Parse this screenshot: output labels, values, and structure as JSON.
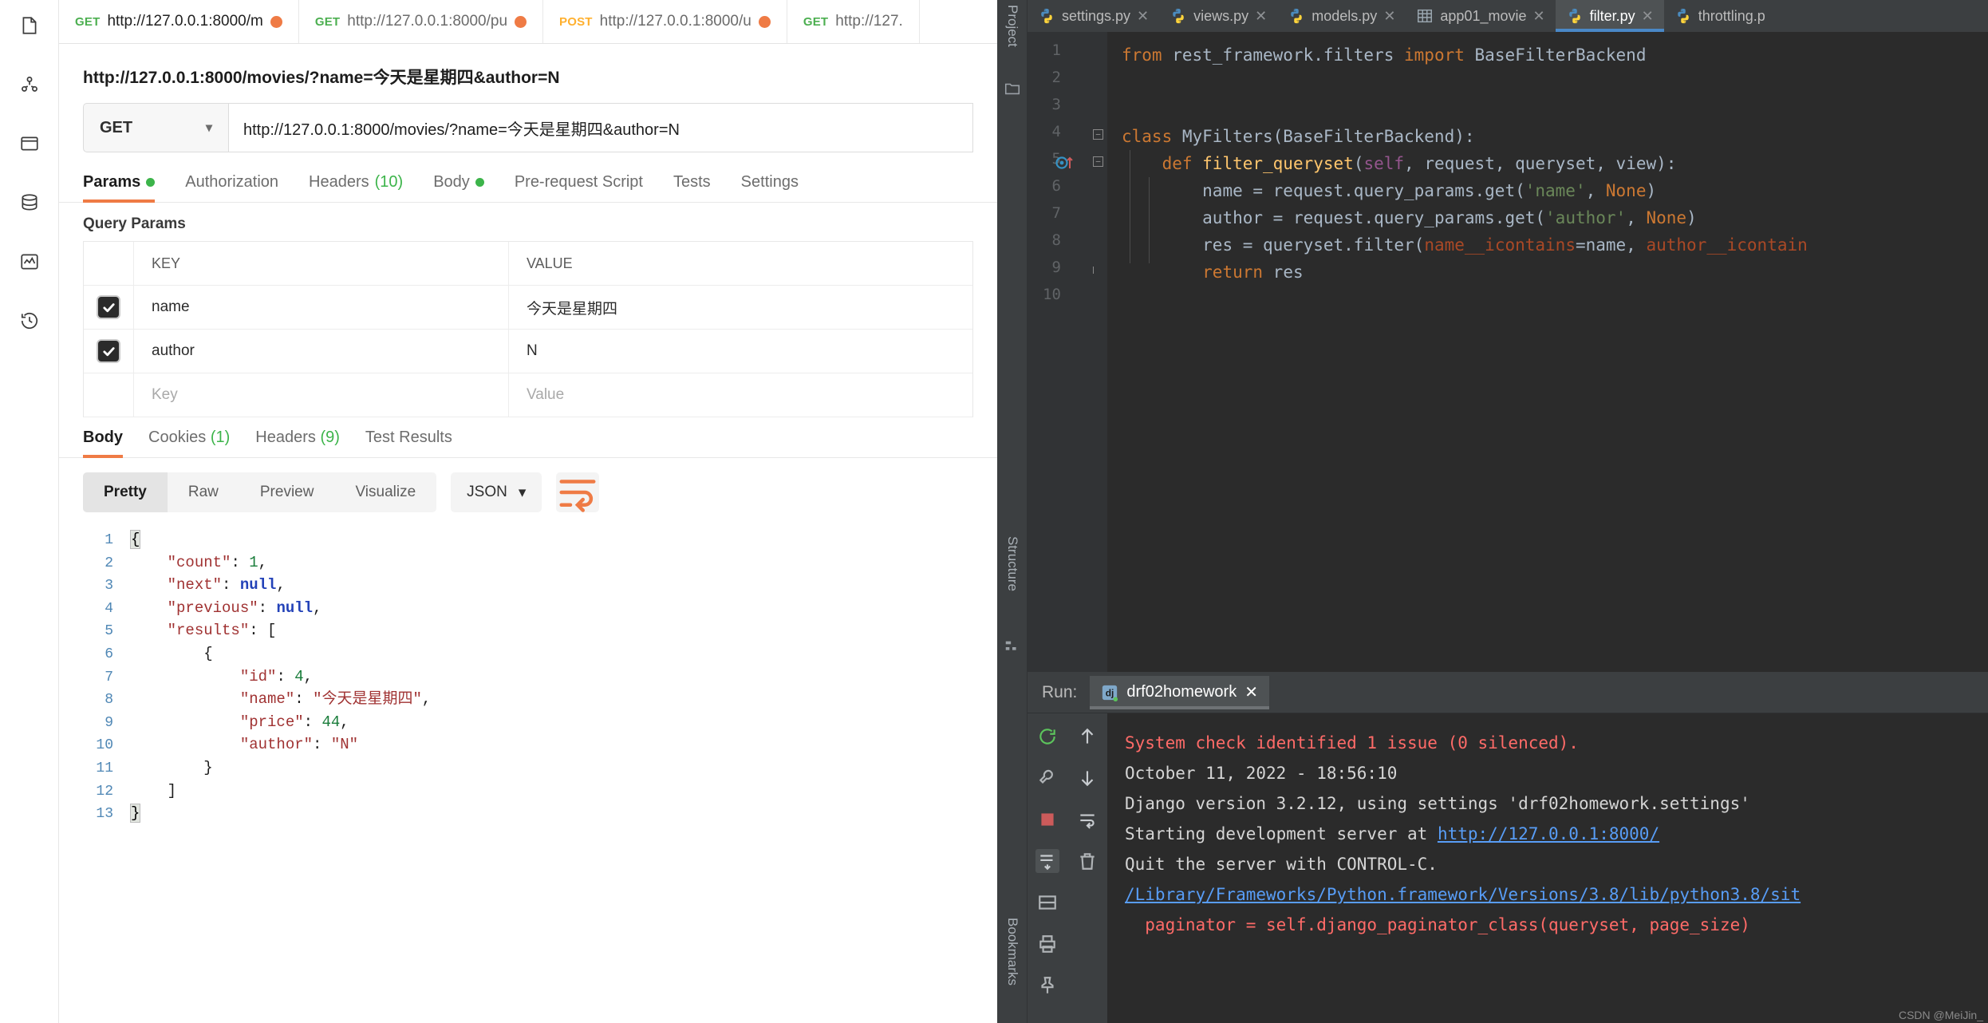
{
  "postman": {
    "rail_icons": [
      "collections-icon",
      "apis-icon",
      "environments-icon",
      "mock-servers-icon",
      "monitors-icon",
      "history-icon"
    ],
    "tabs": [
      {
        "method": "GET",
        "method_class": "get",
        "url": "http://127.0.0.1:8000/m",
        "unsaved": true,
        "active": true
      },
      {
        "method": "GET",
        "method_class": "get",
        "url": "http://127.0.0.1:8000/pu",
        "unsaved": true,
        "active": false
      },
      {
        "method": "POST",
        "method_class": "post",
        "url": "http://127.0.0.1:8000/u",
        "unsaved": true,
        "active": false
      },
      {
        "method": "GET",
        "method_class": "get",
        "url": "http://127.",
        "unsaved": false,
        "active": false
      }
    ],
    "request_name": "http://127.0.0.1:8000/movies/?name=今天是星期四&author=N",
    "method_selected": "GET",
    "url_value": "http://127.0.0.1:8000/movies/?name=今天是星期四&author=N",
    "request_tabs": [
      {
        "label": "Params",
        "dot": true,
        "active": true
      },
      {
        "label": "Authorization",
        "dot": false,
        "active": false
      },
      {
        "label": "Headers",
        "count": "(10)",
        "active": false
      },
      {
        "label": "Body",
        "dot": true,
        "active": false
      },
      {
        "label": "Pre-request Script",
        "active": false
      },
      {
        "label": "Tests",
        "active": false
      },
      {
        "label": "Settings",
        "active": false
      }
    ],
    "query_params_title": "Query Params",
    "table_headers": {
      "key": "KEY",
      "value": "VALUE"
    },
    "params": [
      {
        "checked": true,
        "key": "name",
        "value": "今天是星期四"
      },
      {
        "checked": true,
        "key": "author",
        "value": "N"
      }
    ],
    "new_row": {
      "key_placeholder": "Key",
      "value_placeholder": "Value"
    },
    "response_tabs": [
      {
        "label": "Body",
        "active": true
      },
      {
        "label": "Cookies",
        "count": "(1)",
        "active": false
      },
      {
        "label": "Headers",
        "count": "(9)",
        "active": false
      },
      {
        "label": "Test Results",
        "active": false
      }
    ],
    "view_modes": [
      {
        "label": "Pretty",
        "active": true
      },
      {
        "label": "Raw",
        "active": false
      },
      {
        "label": "Preview",
        "active": false
      },
      {
        "label": "Visualize",
        "active": false
      }
    ],
    "format_selected": "JSON",
    "wrap_icon": "wrap-lines-icon",
    "response_body_lines": [
      {
        "n": "1",
        "indent": 0,
        "tokens": [
          {
            "t": "{",
            "c": "brace-hl"
          }
        ]
      },
      {
        "n": "2",
        "indent": 1,
        "tokens": [
          {
            "t": "\"count\"",
            "c": "tk-key"
          },
          {
            "t": ": ",
            "c": "tk-pl"
          },
          {
            "t": "1",
            "c": "tk-num"
          },
          {
            "t": ",",
            "c": "tk-pl"
          }
        ]
      },
      {
        "n": "3",
        "indent": 1,
        "tokens": [
          {
            "t": "\"next\"",
            "c": "tk-key"
          },
          {
            "t": ": ",
            "c": "tk-pl"
          },
          {
            "t": "null",
            "c": "tk-null"
          },
          {
            "t": ",",
            "c": "tk-pl"
          }
        ]
      },
      {
        "n": "4",
        "indent": 1,
        "tokens": [
          {
            "t": "\"previous\"",
            "c": "tk-key"
          },
          {
            "t": ": ",
            "c": "tk-pl"
          },
          {
            "t": "null",
            "c": "tk-null"
          },
          {
            "t": ",",
            "c": "tk-pl"
          }
        ]
      },
      {
        "n": "5",
        "indent": 1,
        "tokens": [
          {
            "t": "\"results\"",
            "c": "tk-key"
          },
          {
            "t": ": [",
            "c": "tk-pl"
          }
        ]
      },
      {
        "n": "6",
        "indent": 2,
        "tokens": [
          {
            "t": "{",
            "c": "tk-pl"
          }
        ]
      },
      {
        "n": "7",
        "indent": 3,
        "tokens": [
          {
            "t": "\"id\"",
            "c": "tk-key"
          },
          {
            "t": ": ",
            "c": "tk-pl"
          },
          {
            "t": "4",
            "c": "tk-num"
          },
          {
            "t": ",",
            "c": "tk-pl"
          }
        ]
      },
      {
        "n": "8",
        "indent": 3,
        "tokens": [
          {
            "t": "\"name\"",
            "c": "tk-key"
          },
          {
            "t": ": ",
            "c": "tk-pl"
          },
          {
            "t": "\"今天是星期四\"",
            "c": "tk-str"
          },
          {
            "t": ",",
            "c": "tk-pl"
          }
        ]
      },
      {
        "n": "9",
        "indent": 3,
        "tokens": [
          {
            "t": "\"price\"",
            "c": "tk-key"
          },
          {
            "t": ": ",
            "c": "tk-pl"
          },
          {
            "t": "44",
            "c": "tk-num"
          },
          {
            "t": ",",
            "c": "tk-pl"
          }
        ]
      },
      {
        "n": "10",
        "indent": 3,
        "tokens": [
          {
            "t": "\"author\"",
            "c": "tk-key"
          },
          {
            "t": ": ",
            "c": "tk-pl"
          },
          {
            "t": "\"N\"",
            "c": "tk-str"
          }
        ]
      },
      {
        "n": "11",
        "indent": 2,
        "tokens": [
          {
            "t": "}",
            "c": "tk-pl"
          }
        ]
      },
      {
        "n": "12",
        "indent": 1,
        "tokens": [
          {
            "t": "]",
            "c": "tk-pl"
          }
        ]
      },
      {
        "n": "13",
        "indent": 0,
        "tokens": [
          {
            "t": "}",
            "c": "brace-hl"
          }
        ]
      }
    ]
  },
  "pycharm": {
    "sidebar_labels": {
      "project": "Project",
      "structure": "Structure",
      "bookmarks": "Bookmarks"
    },
    "editor_tabs": [
      {
        "label": "settings.py",
        "icon": "python-file-icon",
        "active": false,
        "closable": true
      },
      {
        "label": "views.py",
        "icon": "python-file-icon",
        "active": false,
        "closable": true
      },
      {
        "label": "models.py",
        "icon": "python-file-icon",
        "active": false,
        "closable": true
      },
      {
        "label": "app01_movie",
        "icon": "database-table-icon",
        "active": false,
        "closable": true
      },
      {
        "label": "filter.py",
        "icon": "python-file-icon",
        "active": true,
        "closable": true
      },
      {
        "label": "throttling.p",
        "icon": "python-file-icon",
        "active": false,
        "closable": false
      }
    ],
    "code_lines": [
      {
        "n": "1",
        "indent": 0,
        "tokens": [
          {
            "t": "from ",
            "c": "k-kw"
          },
          {
            "t": "rest_framework.filters ",
            "c": "k-txt"
          },
          {
            "t": "import ",
            "c": "k-kw"
          },
          {
            "t": "BaseFilterBackend",
            "c": "k-txt"
          }
        ]
      },
      {
        "n": "2",
        "indent": 0,
        "tokens": []
      },
      {
        "n": "3",
        "indent": 0,
        "tokens": []
      },
      {
        "n": "4",
        "indent": 0,
        "tokens": [
          {
            "t": "class ",
            "c": "k-kw"
          },
          {
            "t": "MyFilters(BaseFilterBackend):",
            "c": "k-cls"
          }
        ]
      },
      {
        "n": "5",
        "indent": 1,
        "tokens": [
          {
            "t": "def ",
            "c": "k-kw"
          },
          {
            "t": "filter_queryset",
            "c": "k-def"
          },
          {
            "t": "(",
            "c": "k-txt"
          },
          {
            "t": "self",
            "c": "k-self"
          },
          {
            "t": ", request, queryset, view):",
            "c": "k-txt"
          }
        ]
      },
      {
        "n": "6",
        "indent": 2,
        "tokens": [
          {
            "t": "name = request.query_params.get(",
            "c": "k-txt"
          },
          {
            "t": "'name'",
            "c": "k-str"
          },
          {
            "t": ", ",
            "c": "k-txt"
          },
          {
            "t": "None",
            "c": "k-kw"
          },
          {
            "t": ")",
            "c": "k-txt"
          }
        ]
      },
      {
        "n": "7",
        "indent": 2,
        "tokens": [
          {
            "t": "author = request.query_params.get(",
            "c": "k-txt"
          },
          {
            "t": "'author'",
            "c": "k-str"
          },
          {
            "t": ", ",
            "c": "k-txt"
          },
          {
            "t": "None",
            "c": "k-kw"
          },
          {
            "t": ")",
            "c": "k-txt"
          }
        ]
      },
      {
        "n": "8",
        "indent": 2,
        "tokens": [
          {
            "t": "res = queryset.filter(",
            "c": "k-txt"
          },
          {
            "t": "name__icontains",
            "c": "k-kwarg"
          },
          {
            "t": "=name, ",
            "c": "k-txt"
          },
          {
            "t": "author__icontain",
            "c": "k-kwarg"
          }
        ]
      },
      {
        "n": "9",
        "indent": 2,
        "tokens": [
          {
            "t": "return ",
            "c": "k-kw"
          },
          {
            "t": "res",
            "c": "k-txt"
          }
        ]
      },
      {
        "n": "10",
        "indent": 0,
        "tokens": []
      }
    ],
    "run_panel": {
      "label": "Run:",
      "config_name": "drf02homework",
      "toolbar_icons": [
        "rerun-icon",
        "scroll-up-icon",
        "settings-wrench-icon",
        "scroll-down-icon",
        "stop-icon",
        "soft-wrap-icon",
        "scroll-to-end-icon",
        "layout-icon",
        "print-icon",
        "pin-icon",
        "trash-icon"
      ],
      "console_lines": [
        {
          "segments": [
            {
              "t": "System check identified 1 issue (0 silenced).",
              "c": "c-red"
            }
          ]
        },
        {
          "segments": [
            {
              "t": "October 11, 2022 - 18:56:10",
              "c": "c-white"
            }
          ]
        },
        {
          "segments": [
            {
              "t": "Django version 3.2.12, using settings 'drf02homework.settings'",
              "c": "c-white"
            }
          ]
        },
        {
          "segments": [
            {
              "t": "Starting development server at ",
              "c": "c-white"
            },
            {
              "t": "http://127.0.0.1:8000/",
              "c": "c-link"
            }
          ]
        },
        {
          "segments": [
            {
              "t": "Quit the server with CONTROL-C.",
              "c": "c-white"
            }
          ]
        },
        {
          "segments": [
            {
              "t": "/Library/Frameworks/Python.framework/Versions/3.8/lib/python3.8/sit",
              "c": "c-link"
            }
          ]
        },
        {
          "segments": [
            {
              "t": "  paginator = self.django_paginator_class(queryset, page_size)",
              "c": "c-red"
            }
          ]
        }
      ],
      "watermark": "CSDN @MeiJin_"
    }
  }
}
